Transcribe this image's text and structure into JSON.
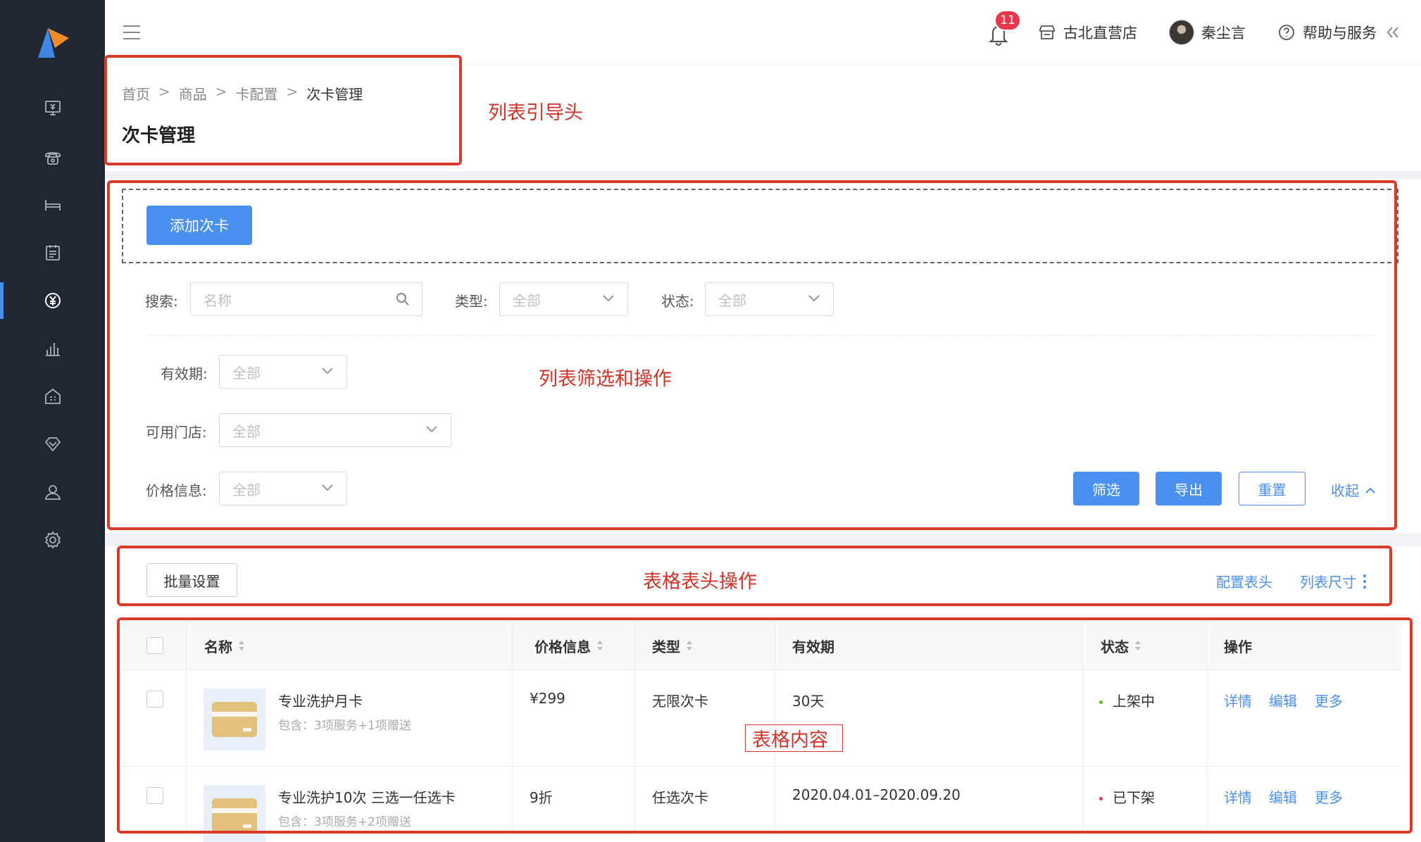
{
  "topbar": {
    "notification_count": "11",
    "store_name": "古北直营店",
    "user_name": "秦尘言",
    "help_label": "帮助与服务"
  },
  "sidebar": {
    "items": [
      {
        "icon": "monitor-yen-icon"
      },
      {
        "icon": "phone-icon"
      },
      {
        "icon": "bed-icon"
      },
      {
        "icon": "clipboard-icon"
      },
      {
        "icon": "yen-circle-icon",
        "active": true
      },
      {
        "icon": "bar-chart-icon"
      },
      {
        "icon": "building-icon"
      },
      {
        "icon": "diamond-icon"
      },
      {
        "icon": "user-icon"
      },
      {
        "icon": "gear-icon"
      }
    ]
  },
  "breadcrumb": {
    "items": [
      "首页",
      "商品",
      "卡配置",
      "次卡管理"
    ]
  },
  "page_title": "次卡管理",
  "toolbar": {
    "add_button": "添加次卡"
  },
  "filters": {
    "search_label": "搜索:",
    "search_placeholder": "名称",
    "type_label": "类型:",
    "type_value": "全部",
    "status_label": "状态:",
    "status_value": "全部",
    "validity_label": "有效期:",
    "validity_value": "全部",
    "store_label": "可用门店:",
    "store_value": "全部",
    "price_label": "价格信息:",
    "price_value": "全部",
    "filter_button": "筛选",
    "export_button": "导出",
    "reset_button": "重置",
    "collapse_link": "收起"
  },
  "table_actions": {
    "batch_button": "批量设置",
    "config_header_link": "配置表头",
    "list_size_link": "列表尺寸"
  },
  "table": {
    "columns": [
      "名称",
      "价格信息",
      "类型",
      "有效期",
      "状态",
      "操作"
    ],
    "rows": [
      {
        "name": "专业洗护月卡",
        "desc": "包含：3项服务+1项赠送",
        "price": "¥299",
        "type": "无限次卡",
        "validity": "30天",
        "status": "上架中",
        "ops": [
          "详情",
          "编辑",
          "更多"
        ]
      },
      {
        "name": "专业洗护10次 三选一任选卡",
        "desc": "包含：3项服务+2项赠送",
        "price": "9折",
        "type": "任选次卡",
        "validity": "2020.04.01–2020.09.20",
        "status": "已下架",
        "ops": [
          "详情",
          "编辑",
          "更多"
        ]
      }
    ]
  },
  "annotations": {
    "header": "列表引导头",
    "filter": "列表筛选和操作",
    "table_header": "表格表头操作",
    "table_content": "表格内容"
  },
  "colors": {
    "sidebar_bg": "#1f2733",
    "primary": "#4a90f0",
    "annotation_red": "#d93a2b",
    "status_on": "#52c41a",
    "status_off": "#e8374a"
  }
}
